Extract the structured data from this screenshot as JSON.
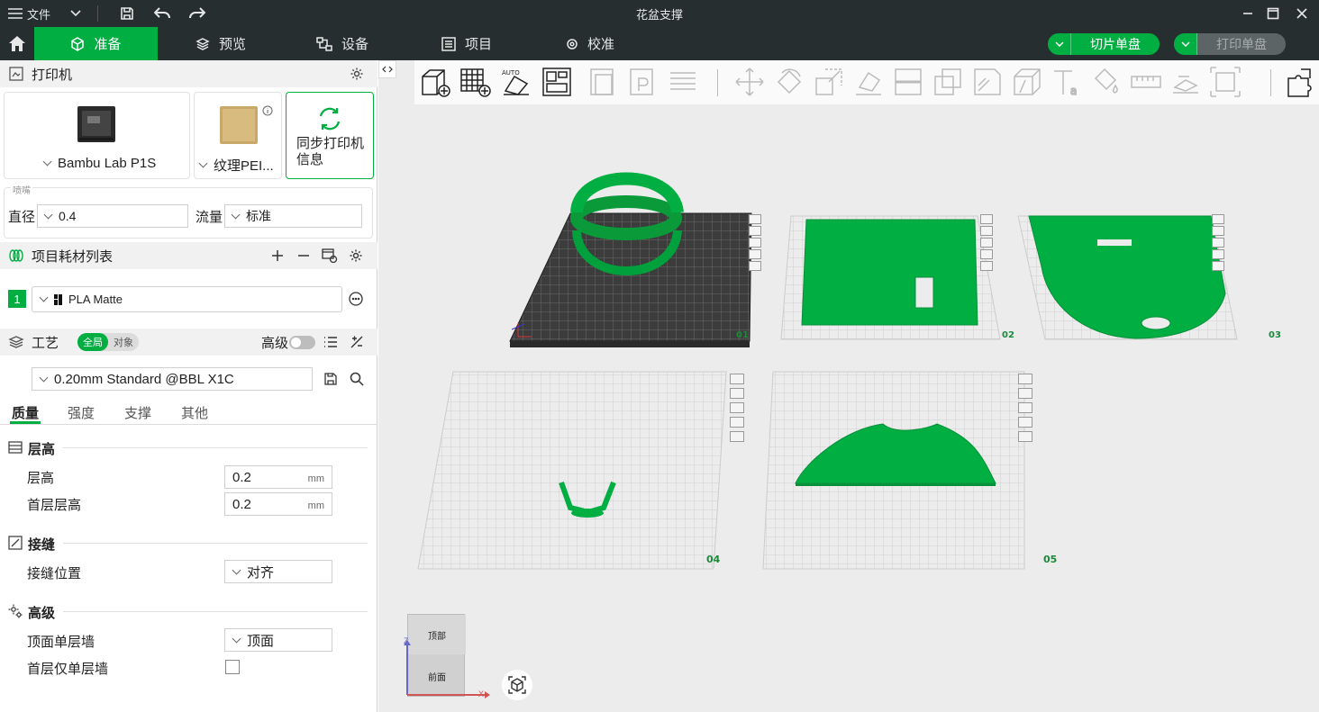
{
  "app": {
    "menu_label": "文件",
    "window_title": "花盆支撑"
  },
  "nav": {
    "tabs": [
      {
        "label": "准备",
        "active": true
      },
      {
        "label": "预览",
        "active": false
      },
      {
        "label": "设备",
        "active": false
      },
      {
        "label": "项目",
        "active": false
      },
      {
        "label": "校准",
        "active": false
      }
    ],
    "slice_label": "切片单盘",
    "print_label": "打印单盘"
  },
  "printer": {
    "section_title": "打印机",
    "printer_name": "Bambu Lab P1S",
    "plate_name": "纹理PEI...",
    "sync_label": "同步打印机信息",
    "nozzle_title": "喷嘴",
    "diameter_label": "直径",
    "diameter_value": "0.4",
    "flow_label": "流量",
    "flow_value": "标准"
  },
  "filament": {
    "section_title": "项目耗材列表",
    "slot": "1",
    "name": "PLA Matte",
    "color": "#00ae42"
  },
  "process": {
    "section_title": "工艺",
    "toggle_global": "全局",
    "toggle_object": "对象",
    "advanced_label": "高级",
    "profile": "0.20mm Standard @BBL X1C",
    "tabs": [
      "质量",
      "强度",
      "支撑",
      "其他"
    ],
    "groups": [
      {
        "title": "层高",
        "rows": [
          {
            "label": "层高",
            "value": "0.2",
            "unit": "mm"
          },
          {
            "label": "首层层高",
            "value": "0.2",
            "unit": "mm"
          }
        ]
      },
      {
        "title": "接缝",
        "rows": [
          {
            "label": "接缝位置",
            "value": "对齐"
          }
        ]
      },
      {
        "title": "高级",
        "rows": [
          {
            "label": "顶面单层墙",
            "value": "顶面"
          },
          {
            "label": "首层仅单层墙",
            "checked": false
          }
        ]
      }
    ]
  },
  "viewport": {
    "plates": [
      "01",
      "02",
      "03",
      "04",
      "05"
    ],
    "view_cube_top": "顶部",
    "view_cube_front": "前面",
    "axis_z": "Z",
    "axis_x": "X",
    "accent": "#00ae42"
  }
}
